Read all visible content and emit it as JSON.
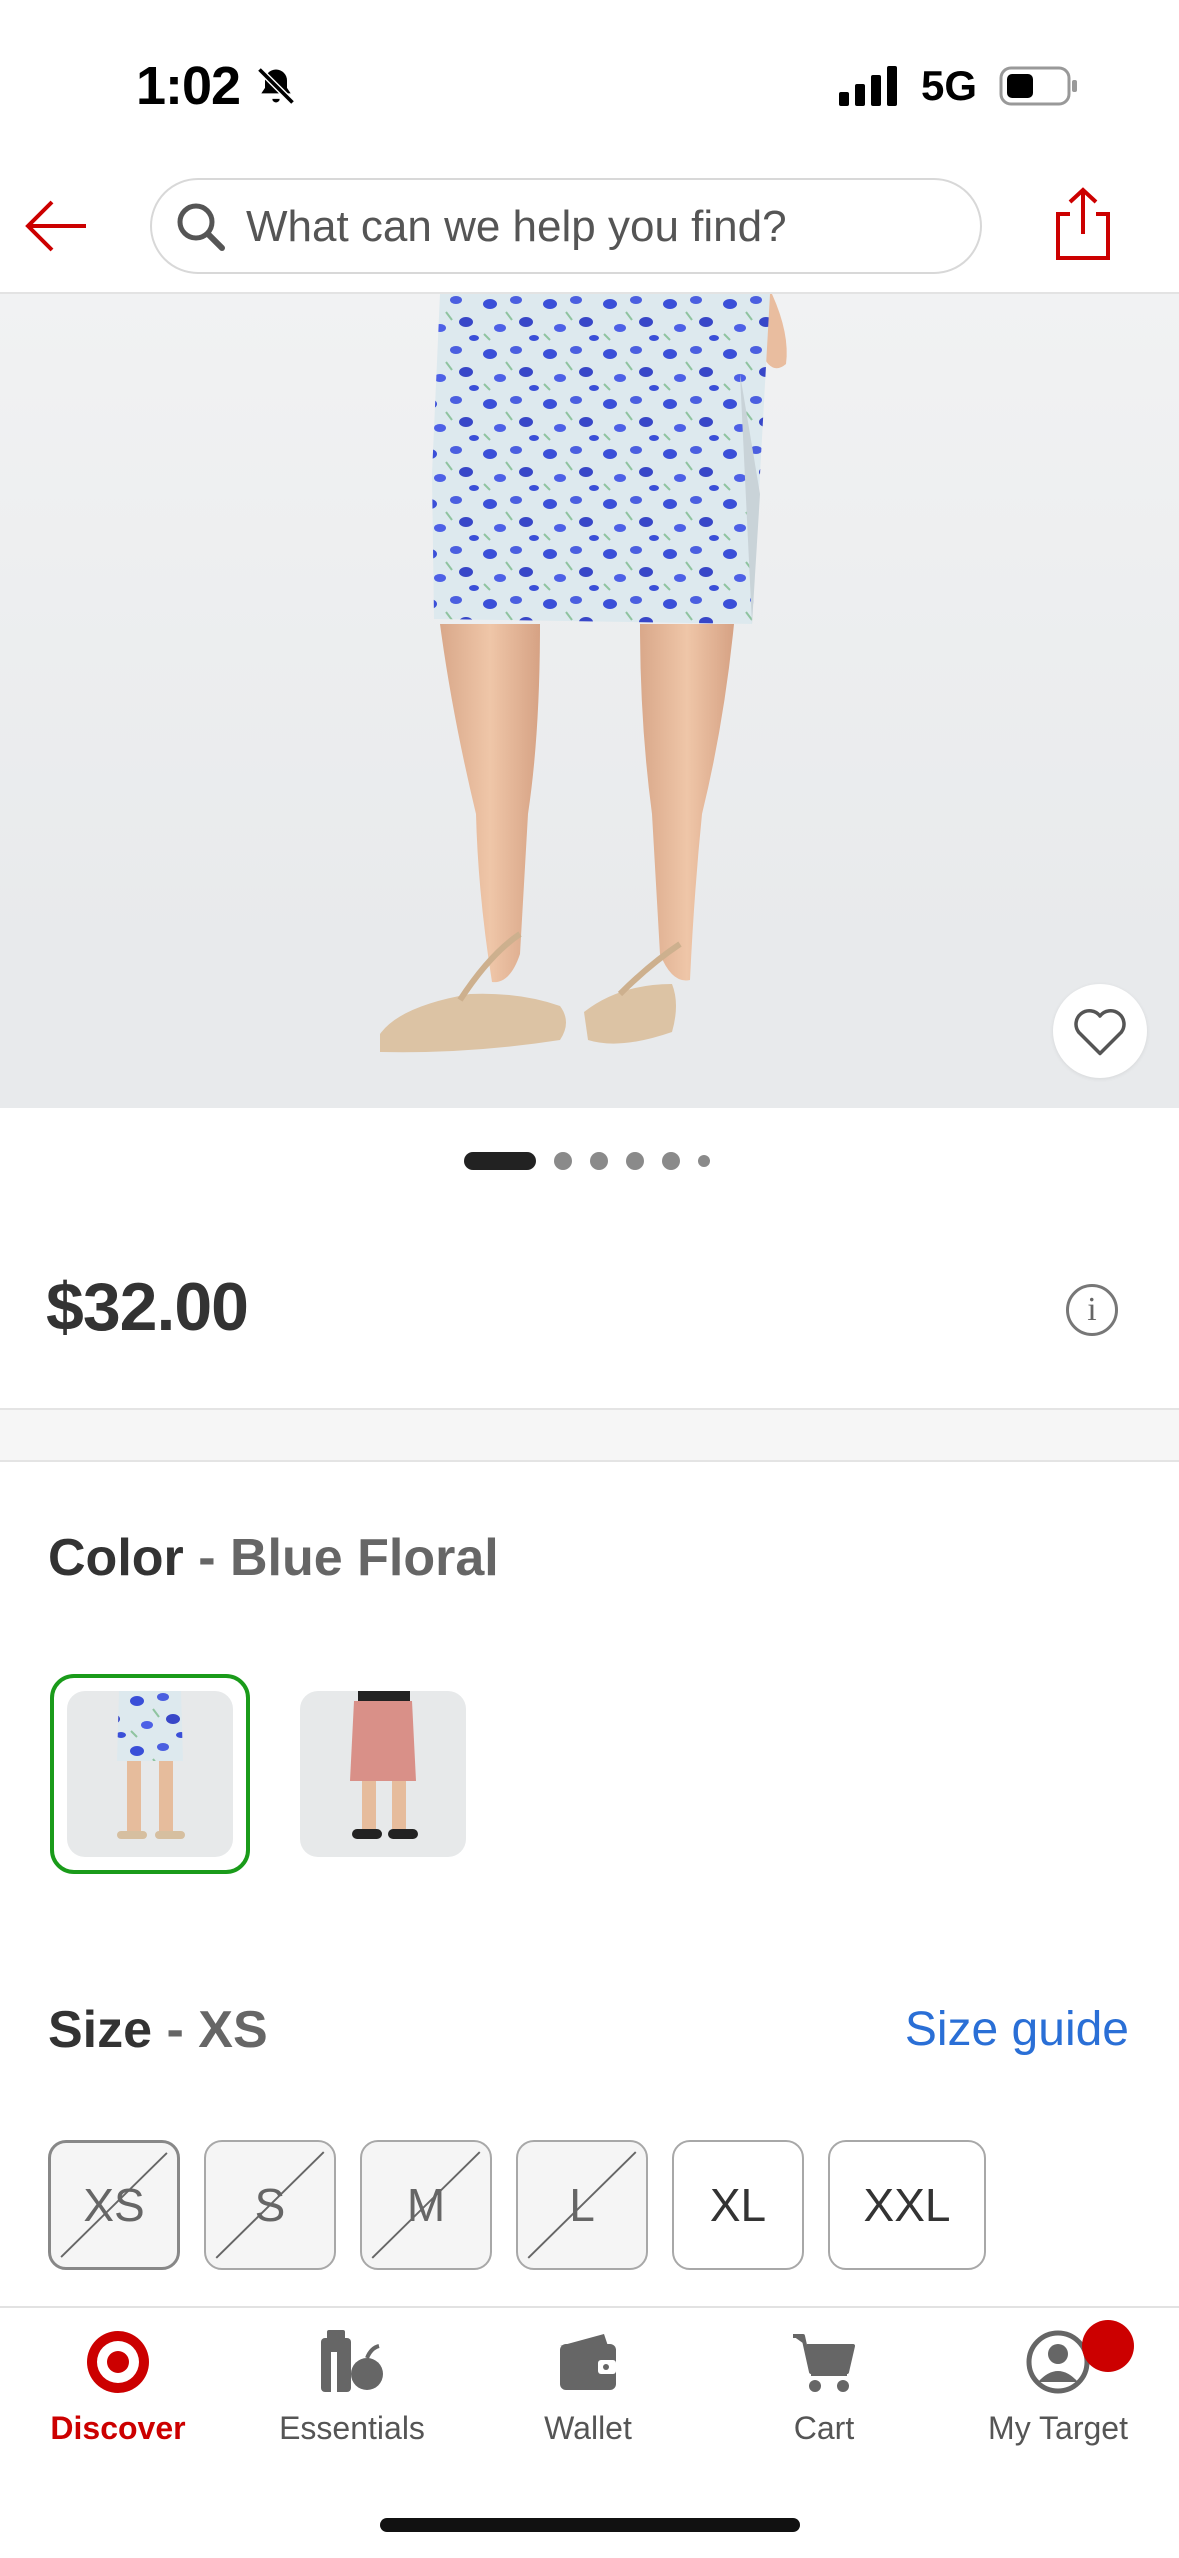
{
  "status_bar": {
    "time": "1:02",
    "network": "5G"
  },
  "header": {
    "search_placeholder": "What can we help you find?"
  },
  "product": {
    "price": "$32.00",
    "carousel": {
      "total": 6,
      "active_index": 0
    },
    "color": {
      "label": "Color",
      "separator": "-",
      "value": "Blue Floral",
      "options": [
        "blue-floral",
        "pink"
      ],
      "selected_index": 0
    },
    "size": {
      "label": "Size",
      "separator": "-",
      "value": "XS",
      "guide_label": "Size guide",
      "options": [
        {
          "label": "XS",
          "available": false,
          "selected": true
        },
        {
          "label": "S",
          "available": false,
          "selected": false
        },
        {
          "label": "M",
          "available": false,
          "selected": false
        },
        {
          "label": "L",
          "available": false,
          "selected": false
        },
        {
          "label": "XL",
          "available": true,
          "selected": false
        },
        {
          "label": "XXL",
          "available": true,
          "selected": false
        }
      ]
    }
  },
  "tabbar": {
    "tabs": [
      {
        "label": "Discover",
        "icon": "target-logo-icon",
        "active": true
      },
      {
        "label": "Essentials",
        "icon": "essentials-icon",
        "active": false
      },
      {
        "label": "Wallet",
        "icon": "wallet-icon",
        "active": false
      },
      {
        "label": "Cart",
        "icon": "cart-icon",
        "active": false
      },
      {
        "label": "My Target",
        "icon": "account-icon",
        "active": false,
        "badge": true
      }
    ]
  },
  "colors": {
    "brand_red": "#cc0000",
    "selected_green": "#1a9b1a",
    "link_blue": "#2a6fd6"
  }
}
